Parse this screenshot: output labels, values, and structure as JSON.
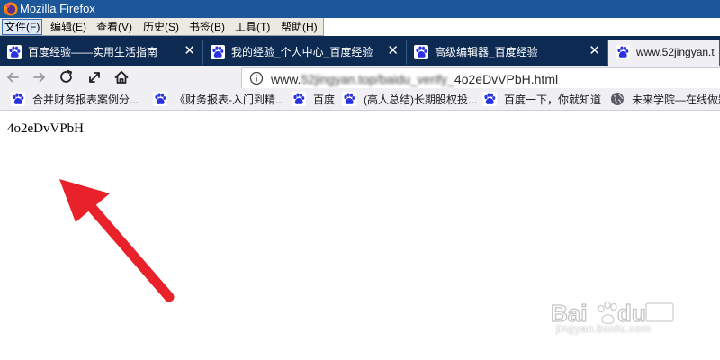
{
  "window": {
    "title": "Mozilla Firefox"
  },
  "menu": {
    "items": [
      "文件(F)",
      "编辑(E)",
      "查看(V)",
      "历史(S)",
      "书签(B)",
      "工具(T)",
      "帮助(H)"
    ]
  },
  "tabs": [
    {
      "label": "百度经验——实用生活指南",
      "icon": "baidu-paw-icon"
    },
    {
      "label": "我的经验_个人中心_百度经验",
      "icon": "baidu-paw-icon"
    },
    {
      "label": "高级编辑器_百度经验",
      "icon": "baidu-paw-icon"
    },
    {
      "label": "www.52jingyan.t",
      "icon": "baidu-paw-icon"
    }
  ],
  "navbar": {
    "back_icon": "back-arrow-icon",
    "forward_icon": "forward-arrow-icon",
    "reload_icon": "reload-icon",
    "fullscreen_icon": "expand-icon",
    "home_icon": "home-icon",
    "url_info_icon": "info-icon",
    "url_prefix": "www.",
    "url_blurred": "52jingyan.top/baidu_verify_",
    "url_suffix": "4o2eDvVPbH.html"
  },
  "bookmarks": [
    {
      "label": "合并财务报表案例分...",
      "icon": "baidu-paw-icon"
    },
    {
      "label": "《财务报表-入门到精...",
      "icon": "baidu-paw-icon"
    },
    {
      "label": "百度",
      "icon": "baidu-paw-icon"
    },
    {
      "label": "(高人总结)长期股权投...",
      "icon": "baidu-paw-icon"
    },
    {
      "label": "百度一下，你就知道",
      "icon": "baidu-paw-icon"
    },
    {
      "label": "未来学院—在线做题",
      "icon": "globe-icon"
    }
  ],
  "page": {
    "content_text": "4o2eDvVPbH"
  },
  "watermark": {
    "text": "jingyan.baidu.com",
    "logo_name": "baidu-jingyan-logo"
  },
  "colors": {
    "titlebar": "#1b5799",
    "tabbar": "#0c2a52",
    "toolbar": "#f0f0f4",
    "arrow": "#e8212a",
    "paw_blue": "#2932e1"
  }
}
